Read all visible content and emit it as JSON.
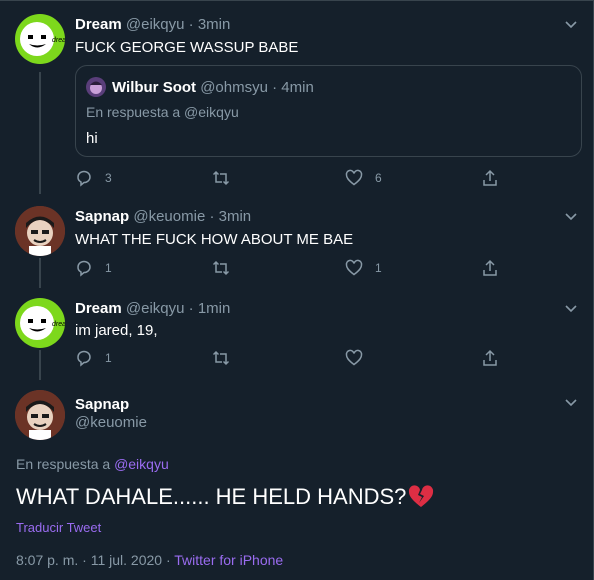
{
  "tweets": [
    {
      "name": "Dream",
      "handle": "@eikqyu",
      "time": "3min",
      "text": "FUCK GEORGE WASSUP BABE",
      "quote": {
        "name": "Wilbur Soot",
        "handle": "@ohmsyu",
        "time": "4min",
        "reply_to": "En respuesta a @eikqyu",
        "text": "hi"
      },
      "replies": "3",
      "retweets": "",
      "likes": "6"
    },
    {
      "name": "Sapnap",
      "handle": "@keuomie",
      "time": "3min",
      "text": "WHAT THE FUCK HOW ABOUT ME BAE",
      "replies": "1",
      "retweets": "",
      "likes": "1"
    },
    {
      "name": "Dream",
      "handle": "@eikqyu",
      "time": "1min",
      "text": "im jared, 19,",
      "replies": "1",
      "retweets": "",
      "likes": ""
    }
  ],
  "main": {
    "name": "Sapnap",
    "handle": "@keuomie",
    "reply_prefix": "En respuesta a",
    "reply_handle": "@eikqyu",
    "text": "WHAT DAHALE...... HE HELD HANDS?",
    "emoji": "broken-heart-icon",
    "translate": "Traducir Tweet",
    "time": "8:07 p. m. · 11 jul. 2020",
    "sep": "·",
    "app": "Twitter for iPhone"
  },
  "colors": {
    "background": "#15202b",
    "accent": "#9a6cf0",
    "muted": "#8899a6",
    "border": "#38444d",
    "dream_green": "#7dd81c"
  }
}
